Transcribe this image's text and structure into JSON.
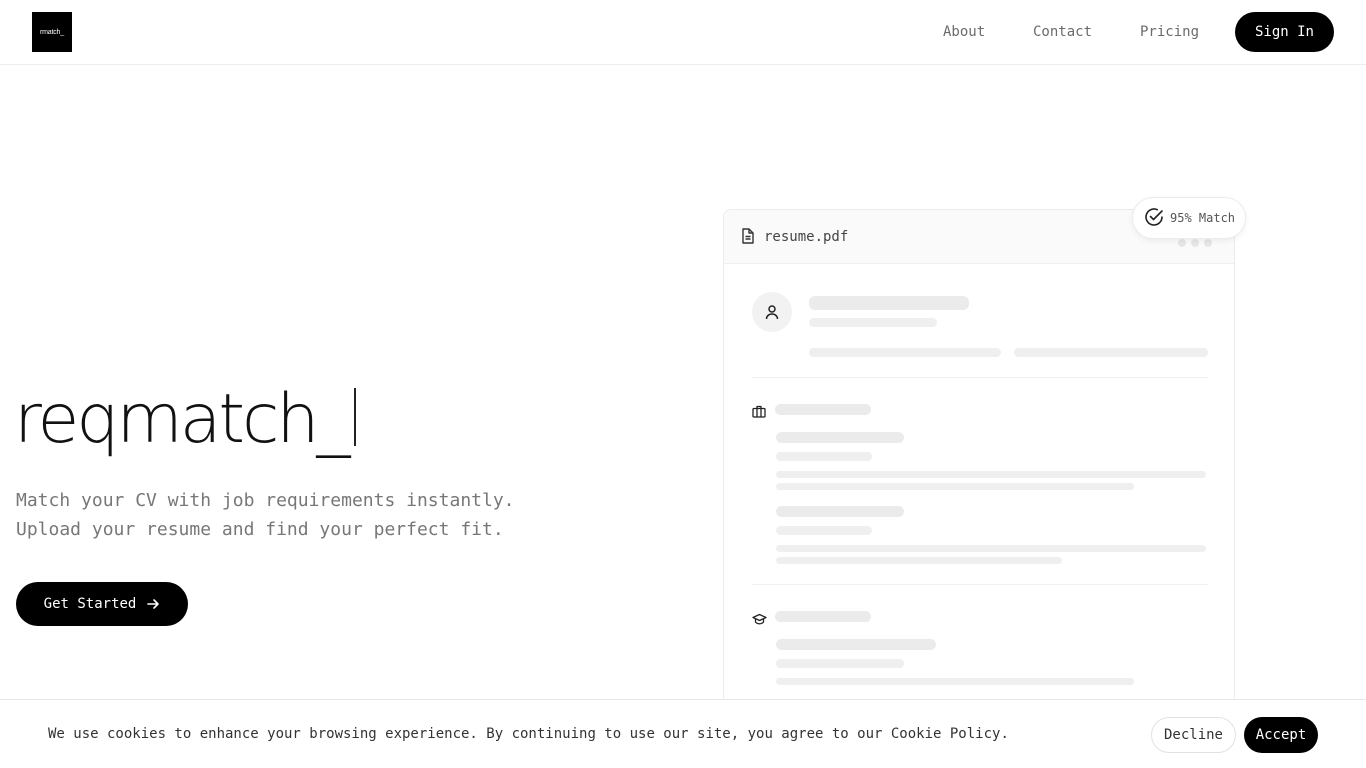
{
  "header": {
    "logo_text": "rmatch_",
    "nav": [
      {
        "label": "About"
      },
      {
        "label": "Contact"
      },
      {
        "label": "Pricing"
      }
    ],
    "signin_label": "Sign In"
  },
  "hero": {
    "title": "reqmatch_",
    "subtitle_line1": "Match your CV with job requirements instantly.",
    "subtitle_line2": "Upload your resume and find your perfect fit.",
    "cta_label": "Get Started"
  },
  "preview": {
    "file_name": "resume.pdf",
    "match_badge": "95% Match"
  },
  "cookie_banner": {
    "text": "We use cookies to enhance your browsing experience. By continuing to use our site, you agree to our Cookie Policy.",
    "decline_label": "Decline",
    "accept_label": "Accept"
  },
  "icons": {
    "file": "file-text-icon",
    "avatar": "user-icon",
    "experience": "briefcase-icon",
    "education": "graduation-cap-icon",
    "badge": "check-circle-icon",
    "cta": "arrow-right-icon"
  }
}
